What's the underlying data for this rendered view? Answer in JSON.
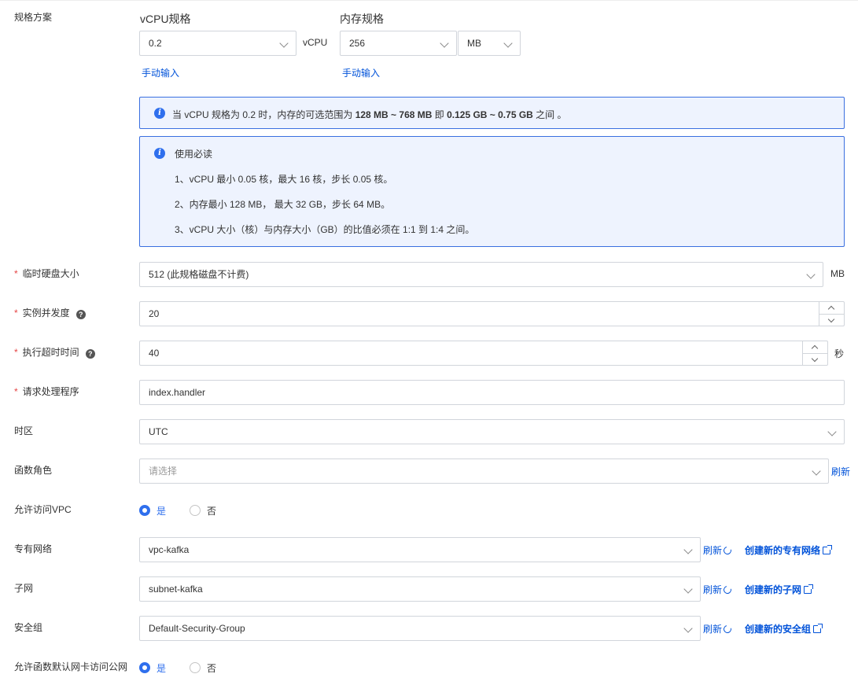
{
  "spec": {
    "label": "规格方案",
    "vcpu_title": "vCPU规格",
    "vcpu_value": "0.2",
    "vcpu_unit": "vCPU",
    "memory_title": "内存规格",
    "memory_value": "256",
    "memory_unit": "MB",
    "manual_input_cpu": "手动输入",
    "manual_input_mem": "手动输入",
    "range_info": {
      "prefix": "当 vCPU 规格为 0.2 时，内存的可选范围为 ",
      "range_mb": "128 MB ~ 768 MB",
      "mid": " 即 ",
      "range_gb": "0.125 GB ~ 0.75 GB",
      "suffix": " 之间 。"
    },
    "notice": {
      "title": "使用必读",
      "lines": [
        "1、vCPU 最小 0.05 核，最大 16 核，步长 0.05 核。",
        "2、内存最小 128 MB， 最大 32 GB，步长 64 MB。",
        "3、vCPU 大小（核）与内存大小（GB）的比值必须在 1:1 到 1:4 之间。"
      ]
    }
  },
  "disk": {
    "label": "临时硬盘大小",
    "value": "512 (此规格磁盘不计费)",
    "unit": "MB"
  },
  "concurrency": {
    "label": "实例并发度",
    "value": "20"
  },
  "timeout": {
    "label": "执行超时时间",
    "value": "40",
    "unit": "秒"
  },
  "handler": {
    "label": "请求处理程序",
    "value": "index.handler"
  },
  "timezone": {
    "label": "时区",
    "value": "UTC"
  },
  "role": {
    "label": "函数角色",
    "placeholder": "请选择",
    "refresh": "刷新"
  },
  "vpc_access": {
    "label": "允许访问VPC",
    "yes": "是",
    "no": "否"
  },
  "vpc": {
    "label": "专有网络",
    "value": "vpc-kafka",
    "refresh": "刷新",
    "create": "创建新的专有网络"
  },
  "subnet": {
    "label": "子网",
    "value": "subnet-kafka",
    "refresh": "刷新",
    "create": "创建新的子网"
  },
  "security_group": {
    "label": "安全组",
    "value": "Default-Security-Group",
    "refresh": "刷新",
    "create": "创建新的安全组"
  },
  "public_access": {
    "label": "允许函数默认网卡访问公网",
    "yes": "是",
    "no": "否"
  },
  "colors": {
    "accent": "#2f6fed",
    "link": "#0052d9",
    "required": "#e54545",
    "info_bg": "#eef3fe",
    "info_border": "#3a6fe0"
  },
  "icons": [
    "chevron-down-icon",
    "info-icon",
    "help-icon",
    "refresh-icon",
    "external-link-icon",
    "arrow-up-icon",
    "arrow-down-icon"
  ]
}
